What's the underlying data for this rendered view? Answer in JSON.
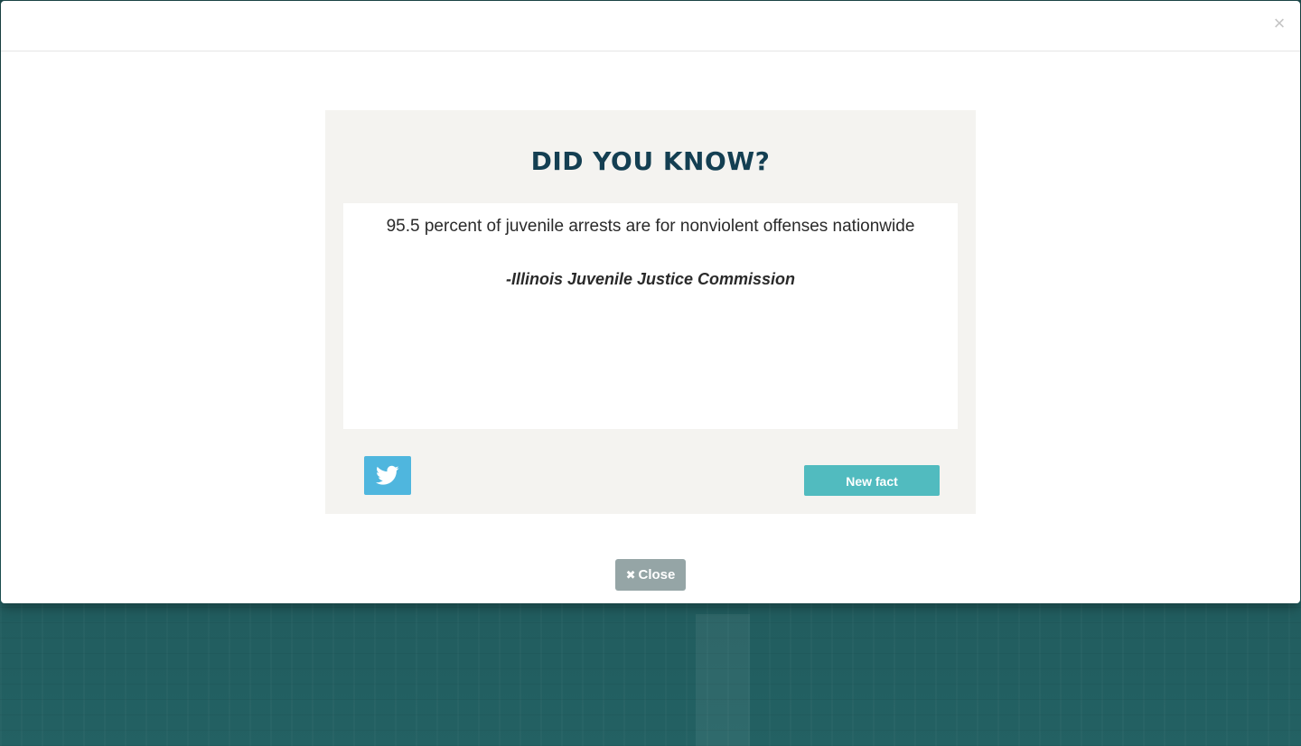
{
  "background": {
    "colors": {
      "top": "#1d4a4c",
      "bottom": "#236163"
    }
  },
  "modal": {
    "close_icon_glyph": "×",
    "fact": {
      "title": "DID YOU KNOW?",
      "text": "95.5 percent of juvenile arrests are for nonviolent offenses nationwide",
      "source": "-Illinois Juvenile Justice Commission",
      "twitter_icon": "twitter-bird-icon",
      "new_fact_label": "New fact"
    },
    "close_button": {
      "icon": "close-icon",
      "icon_glyph": "✖",
      "label": "Close"
    },
    "colors": {
      "title": "#143f52",
      "card_bg": "#f4f3f0",
      "twitter": "#4fb6de",
      "new_fact": "#51bbbf",
      "close": "#95a5a6"
    }
  }
}
